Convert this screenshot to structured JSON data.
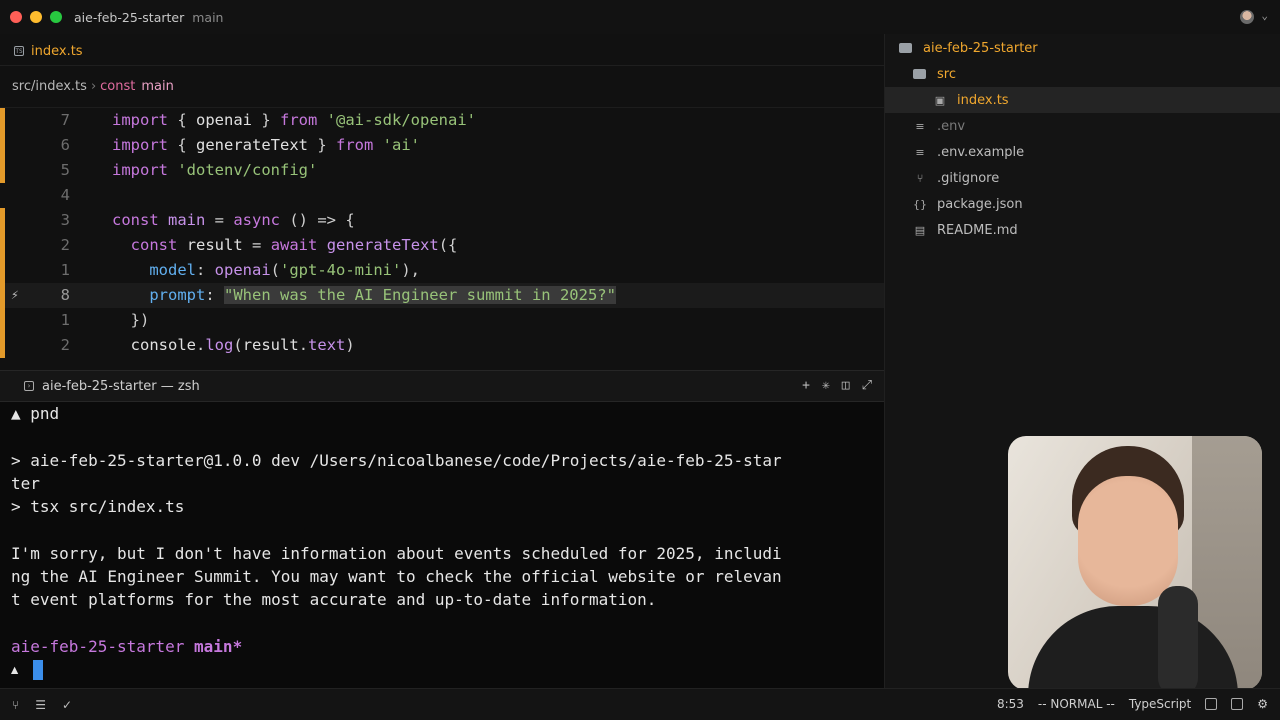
{
  "window": {
    "title": "aie-feb-25-starter",
    "branch": "main"
  },
  "editor": {
    "tab_label": "index.ts",
    "breadcrumb": {
      "file": "src/index.ts",
      "separator": "›",
      "keyword": "const",
      "symbol": "main"
    },
    "lines": [
      {
        "num": "7",
        "tokens": [
          [
            "kw",
            "import"
          ],
          [
            "pun",
            " { "
          ],
          [
            "id",
            "openai"
          ],
          [
            "pun",
            " } "
          ],
          [
            "kw",
            "from"
          ],
          [
            "pun",
            " "
          ],
          [
            "str",
            "'@ai-sdk/openai'"
          ]
        ]
      },
      {
        "num": "6",
        "tokens": [
          [
            "kw",
            "import"
          ],
          [
            "pun",
            " { "
          ],
          [
            "id",
            "generateText"
          ],
          [
            "pun",
            " } "
          ],
          [
            "kw",
            "from"
          ],
          [
            "pun",
            " "
          ],
          [
            "str",
            "'ai'"
          ]
        ]
      },
      {
        "num": "5",
        "tokens": [
          [
            "kw",
            "import"
          ],
          [
            "pun",
            " "
          ],
          [
            "str",
            "'dotenv/config'"
          ]
        ]
      },
      {
        "num": "4",
        "tokens": []
      },
      {
        "num": "3",
        "tokens": [
          [
            "kw",
            "const"
          ],
          [
            "pun",
            " "
          ],
          [
            "fn",
            "main"
          ],
          [
            "pun",
            " = "
          ],
          [
            "kw",
            "async"
          ],
          [
            "pun",
            " () => {"
          ]
        ]
      },
      {
        "num": "2",
        "tokens": [
          [
            "pun",
            "  "
          ],
          [
            "kw",
            "const"
          ],
          [
            "pun",
            " "
          ],
          [
            "id",
            "result"
          ],
          [
            "pun",
            " = "
          ],
          [
            "kw",
            "await"
          ],
          [
            "pun",
            " "
          ],
          [
            "fn",
            "generateText"
          ],
          [
            "pun",
            "({"
          ]
        ]
      },
      {
        "num": "1",
        "tokens": [
          [
            "pun",
            "    "
          ],
          [
            "prop",
            "model"
          ],
          [
            "pun",
            ": "
          ],
          [
            "fn",
            "openai"
          ],
          [
            "pun",
            "("
          ],
          [
            "str",
            "'gpt-4o-mini'"
          ],
          [
            "pun",
            "),"
          ]
        ]
      },
      {
        "num": "8",
        "tokens": [
          [
            "pun",
            "    "
          ],
          [
            "prop",
            "prompt"
          ],
          [
            "pun",
            ": "
          ],
          [
            "str",
            "\"When was the AI Engineer summit in 2025?\""
          ]
        ]
      },
      {
        "num": "1",
        "tokens": [
          [
            "pun",
            "  })"
          ]
        ]
      },
      {
        "num": "2",
        "tokens": [
          [
            "pun",
            "  "
          ],
          [
            "id",
            "console"
          ],
          [
            "pun",
            "."
          ],
          [
            "mth",
            "log"
          ],
          [
            "pun",
            "("
          ],
          [
            "id",
            "result"
          ],
          [
            "pun",
            "."
          ],
          [
            "mem",
            "text"
          ],
          [
            "pun",
            ")"
          ]
        ]
      }
    ]
  },
  "terminal": {
    "title": "aie-feb-25-starter — zsh",
    "lines": [
      "▲ pnd",
      "",
      "> aie-feb-25-starter@1.0.0 dev /Users/nicoalbanese/code/Projects/aie-feb-25-star",
      "ter",
      "> tsx src/index.ts",
      "",
      "I'm sorry, but I don't have information about events scheduled for 2025, includi",
      "ng the AI Engineer Summit. You may want to check the official website or relevan",
      "t event platforms for the most accurate and up-to-date information.",
      ""
    ],
    "prompt_dir": "aie-feb-25-starter",
    "prompt_branch": "main*",
    "input_marker": "▲"
  },
  "explorer": {
    "root": "aie-feb-25-starter",
    "folder": "src",
    "active_file": "index.ts",
    "files": [
      {
        "icon": "≡",
        "name": ".env",
        "style": "dim"
      },
      {
        "icon": "≡",
        "name": ".env.example",
        "style": "norm"
      },
      {
        "icon": "⑂",
        "name": ".gitignore",
        "style": "norm"
      },
      {
        "icon": "{}",
        "name": "package.json",
        "style": "norm"
      },
      {
        "icon": "▤",
        "name": "README.md",
        "style": "norm"
      }
    ]
  },
  "statusbar": {
    "time": "8:53",
    "mode": "-- NORMAL --",
    "language": "TypeScript"
  }
}
